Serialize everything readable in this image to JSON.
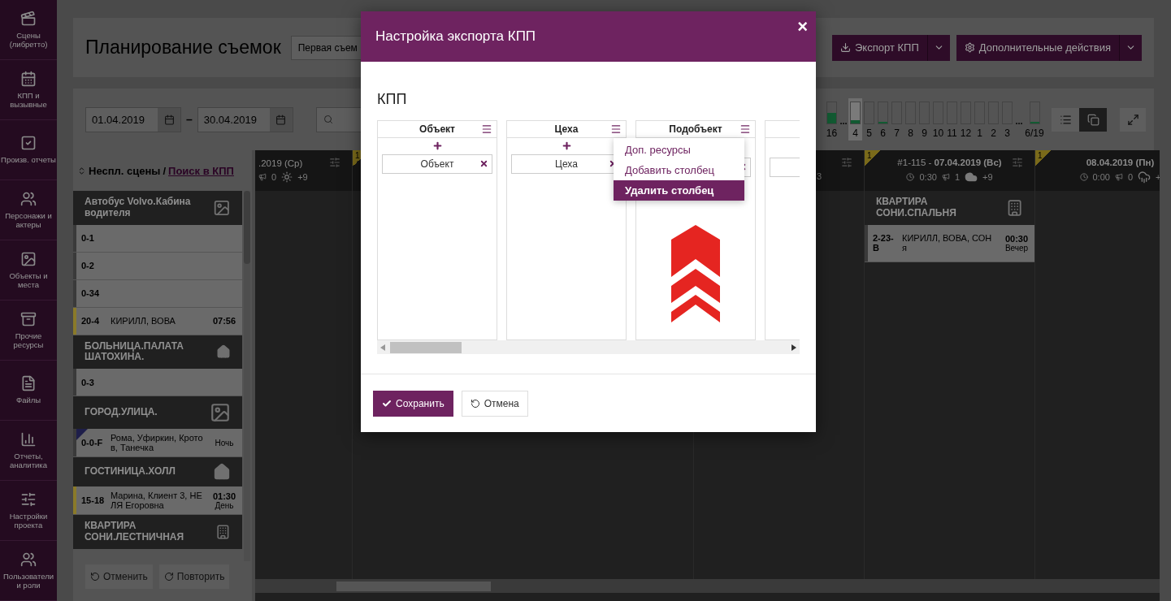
{
  "sidebar": {
    "items": [
      {
        "label": "Сцены (либретто)"
      },
      {
        "label": "КПП и вызывные"
      },
      {
        "label": "Произв. отчеты"
      },
      {
        "label": "Персонажи и актеры"
      },
      {
        "label": "Объекты и места"
      },
      {
        "label": "Прочие ресурсы"
      },
      {
        "label": "Файлы"
      },
      {
        "label": "Отчеты, аналитика"
      },
      {
        "label": "Настройки проекта"
      },
      {
        "label": "Пользователи и роли"
      }
    ]
  },
  "header": {
    "title": "Планирование съемок",
    "version_select": "Первая съем",
    "buttons": [
      {
        "label": "Экспорт КПП"
      },
      {
        "label": "Дополнительные действия"
      }
    ]
  },
  "toolbar": {
    "date_from": "01.04.2019",
    "date_separator": "–",
    "date_to": "30.04.2019",
    "days": [
      {
        "label": "16",
        "level": 0.5,
        "selected": false
      },
      {
        "label": "4",
        "gap_before": "...",
        "level": 0.15,
        "selected": true
      },
      {
        "label": "5",
        "selected": false
      },
      {
        "label": "6",
        "level": 0.05,
        "selected": false
      },
      {
        "label": "7",
        "selected": false
      },
      {
        "label": "8",
        "selected": false
      },
      {
        "label": "9",
        "selected": false
      },
      {
        "label": "10",
        "selected": false
      },
      {
        "label": "11",
        "selected": false
      },
      {
        "label": "12",
        "selected": false
      },
      {
        "label": "1",
        "selected": false
      },
      {
        "label": "2",
        "selected": false
      },
      {
        "label": "3",
        "selected": false
      },
      {
        "label": "6/19",
        "gap_before": "...",
        "level": 0.05,
        "selected": false
      }
    ],
    "views": [
      {
        "selected": false
      },
      {
        "selected": true
      }
    ]
  },
  "scene_list": {
    "tabs": [
      {
        "label": "Неспл. сцены",
        "selected": true
      },
      {
        "label": "Поиск в КПП",
        "selected": false
      }
    ],
    "tab_separator": "/",
    "groups": [
      {
        "title": "Автобус Volvo.Кабина водителя",
        "kind": "exterior",
        "rows": [
          {
            "number": "0-1",
            "color": "#3a3a3a",
            "night": false
          },
          {
            "number": "0-2",
            "color": "#3a3a3a",
            "night": false
          },
          {
            "number": "0-34",
            "color": "#3a3a3a",
            "night": false
          },
          {
            "number": "20-4",
            "cast": "КИРИЛЛ, ВОВА",
            "time": "07:56",
            "color": "#8a7a2a",
            "night": false
          }
        ]
      },
      {
        "title": "БОЛЬНИЦА.ПАЛАТА ШАТОХИНА.",
        "kind": "interior",
        "rows": [
          {
            "number": "0-3",
            "color": "#3a3a3a",
            "night": false
          }
        ]
      },
      {
        "title": "ГОРОД.УЛИЦА.",
        "kind": "exterior",
        "rows": [
          {
            "number": "0-0-F",
            "cast": "Рома, Уфиркин, Кротов, Танечка",
            "period": "Ночь",
            "color": "#3a3a3a",
            "night": true
          }
        ]
      },
      {
        "title": "ГОСТИНИЦА.ХОЛЛ",
        "kind": "interior",
        "rows": [
          {
            "number": "15-18",
            "cast": "Марина, Клиент 3, НЕЛЯ Егоровна",
            "time": "01:30",
            "period": "День",
            "color": "#8a7a2a",
            "night": false
          }
        ]
      },
      {
        "title": "КВАРТИРА СОНИ.ЛЕСТНИЧНАЯ",
        "kind": "building"
      }
    ],
    "buttons": [
      {
        "label": "Отменить"
      },
      {
        "label": "Повторить"
      }
    ]
  },
  "calendar": {
    "days": [
      {
        "title": ".2019 (Ср)",
        "calls": "0",
        "kind": "sun",
        "extra": "+9"
      },
      {
        "badge": "1"
      },
      {
        "tail": "3"
      },
      {
        "badge": "1",
        "title": "#1-115 - **07.04.2019 (Вс)**",
        "duration": "0:30",
        "calls": "1",
        "kind": "cloud",
        "extra": "+9",
        "cards": [
          {
            "location": "КВАРТИРА СОНИ.СПАЛЬНЯ",
            "kind": "building",
            "rows": [
              {
                "number": "2-23-В",
                "cast": "КИРИЛЛ, ВОВА, СОНя",
                "time": "00:30",
                "period": "Вечер"
              }
            ]
          }
        ]
      },
      {
        "badge": "1",
        "title": "**08.04.2019 (Пн)**",
        "duration": "0:00",
        "calls": "0",
        "kind": "rain",
        "extra": "+"
      }
    ]
  },
  "modal": {
    "title": "Настройка экспорта КПП",
    "close": "×",
    "section": "КПП",
    "columns": [
      {
        "title": "Объект",
        "items": [
          {
            "label": "Объект",
            "removable": true
          }
        ]
      },
      {
        "title": "Цеха",
        "items": [
          {
            "label": "Цеха",
            "removable": true
          }
        ]
      },
      {
        "title": "Подобъект",
        "items": [
          {
            "removable": true
          }
        ],
        "menu": [
          {
            "label": "Доп. ресурсы",
            "selected": false
          },
          {
            "label": "Добавить столбец",
            "selected": false
          },
          {
            "label": "Удалить столбец",
            "selected": true
          }
        ]
      },
      {
        "items": [
          {
            "removable": false
          }
        ]
      }
    ],
    "buttons": [
      {
        "label": "Сохранить",
        "kind": "primary"
      },
      {
        "label": "Отмена",
        "kind": "secondary"
      }
    ]
  }
}
